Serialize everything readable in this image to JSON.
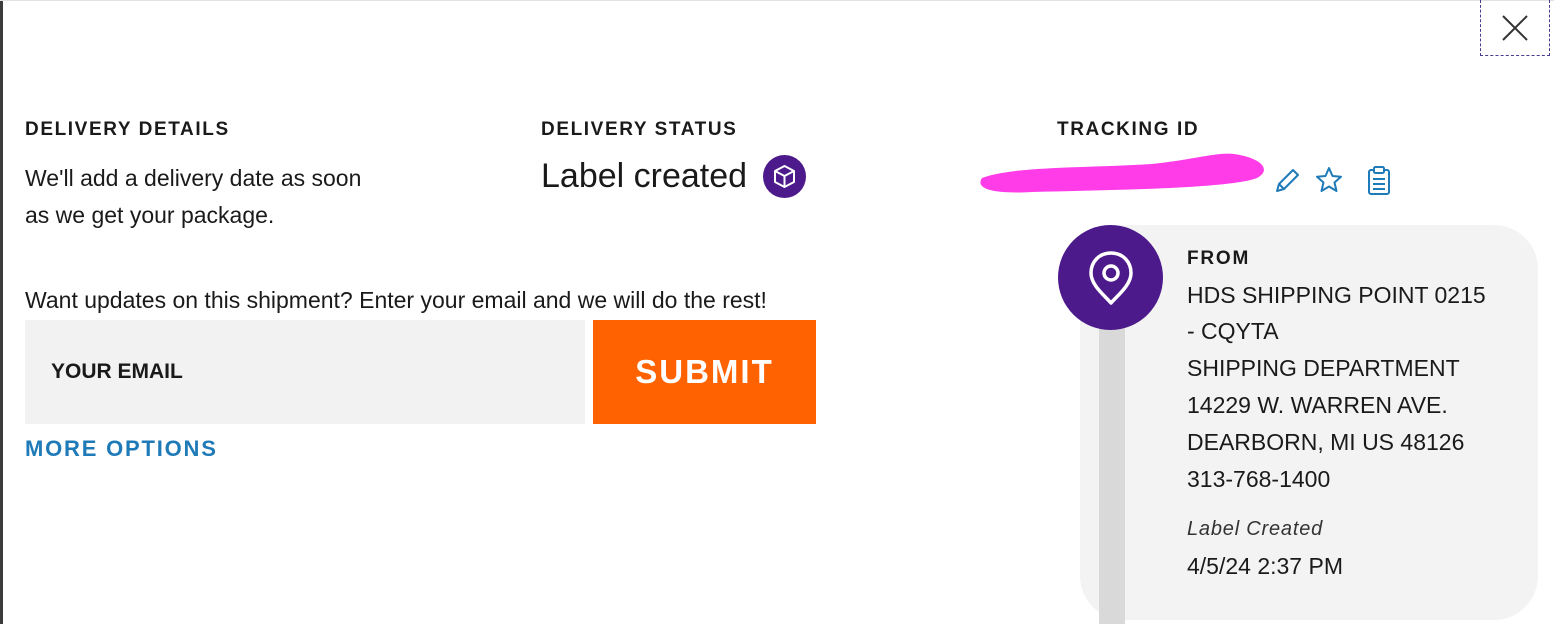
{
  "sections": {
    "delivery_details": {
      "label": "DELIVERY DETAILS",
      "text_line1": "We'll add a delivery date as soon",
      "text_line2": "as we get your package."
    },
    "delivery_status": {
      "label": "DELIVERY STATUS",
      "status": "Label created",
      "status_icon": "package-icon"
    },
    "tracking": {
      "label": "TRACKING ID",
      "tracking_id_redacted": true,
      "actions": [
        "pencil-icon",
        "star-icon",
        "clipboard-icon"
      ]
    }
  },
  "updates": {
    "prompt": "Want updates on this shipment? Enter your email and we will do the rest!",
    "email_placeholder": "YOUR EMAIL",
    "email_value": "",
    "submit_label": "SUBMIT",
    "more_options": "MORE OPTIONS"
  },
  "from": {
    "label": "FROM",
    "lines": [
      "HDS SHIPPING POINT 0215",
      "- CQYTA",
      "SHIPPING DEPARTMENT",
      "14229 W. WARREN AVE.",
      "DEARBORN, MI US 48126",
      "313-768-1400"
    ],
    "event_label": "Label Created",
    "event_time": "4/5/24 2:37 PM"
  },
  "colors": {
    "accent_orange": "#ff6200",
    "brand_purple": "#4d1a8c",
    "link_blue": "#1f7ab8",
    "redaction_magenta": "#ff3ce8"
  }
}
